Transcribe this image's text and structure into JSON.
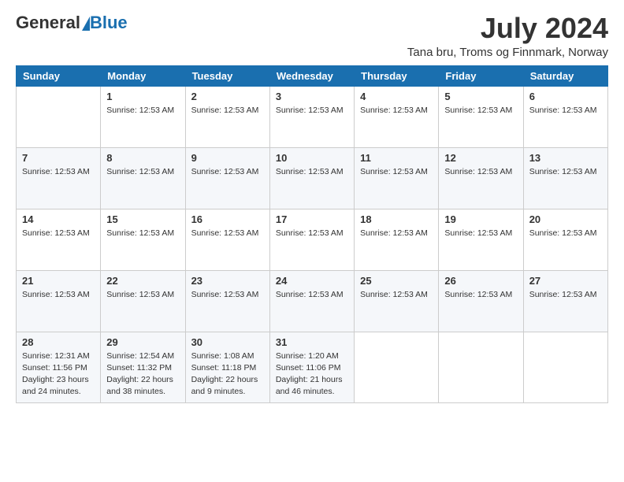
{
  "header": {
    "logo_general": "General",
    "logo_blue": "Blue",
    "month_year": "July 2024",
    "location": "Tana bru, Troms og Finnmark, Norway"
  },
  "weekdays": [
    "Sunday",
    "Monday",
    "Tuesday",
    "Wednesday",
    "Thursday",
    "Friday",
    "Saturday"
  ],
  "weeks": [
    [
      {
        "day": "",
        "info": []
      },
      {
        "day": "1",
        "info": [
          "Sunrise: 12:53 AM"
        ]
      },
      {
        "day": "2",
        "info": [
          "Sunrise: 12:53 AM"
        ]
      },
      {
        "day": "3",
        "info": [
          "Sunrise: 12:53 AM"
        ]
      },
      {
        "day": "4",
        "info": [
          "Sunrise: 12:53 AM"
        ]
      },
      {
        "day": "5",
        "info": [
          "Sunrise: 12:53 AM"
        ]
      },
      {
        "day": "6",
        "info": [
          "Sunrise: 12:53 AM"
        ]
      }
    ],
    [
      {
        "day": "7",
        "info": [
          "Sunrise: 12:53 AM"
        ]
      },
      {
        "day": "8",
        "info": [
          "Sunrise: 12:53 AM"
        ]
      },
      {
        "day": "9",
        "info": [
          "Sunrise: 12:53 AM"
        ]
      },
      {
        "day": "10",
        "info": [
          "Sunrise: 12:53 AM"
        ]
      },
      {
        "day": "11",
        "info": [
          "Sunrise: 12:53 AM"
        ]
      },
      {
        "day": "12",
        "info": [
          "Sunrise: 12:53 AM"
        ]
      },
      {
        "day": "13",
        "info": [
          "Sunrise: 12:53 AM"
        ]
      }
    ],
    [
      {
        "day": "14",
        "info": [
          "Sunrise: 12:53 AM"
        ]
      },
      {
        "day": "15",
        "info": [
          "Sunrise: 12:53 AM"
        ]
      },
      {
        "day": "16",
        "info": [
          "Sunrise: 12:53 AM"
        ]
      },
      {
        "day": "17",
        "info": [
          "Sunrise: 12:53 AM"
        ]
      },
      {
        "day": "18",
        "info": [
          "Sunrise: 12:53 AM"
        ]
      },
      {
        "day": "19",
        "info": [
          "Sunrise: 12:53 AM"
        ]
      },
      {
        "day": "20",
        "info": [
          "Sunrise: 12:53 AM"
        ]
      }
    ],
    [
      {
        "day": "21",
        "info": [
          "Sunrise: 12:53 AM"
        ]
      },
      {
        "day": "22",
        "info": [
          "Sunrise: 12:53 AM"
        ]
      },
      {
        "day": "23",
        "info": [
          "Sunrise: 12:53 AM"
        ]
      },
      {
        "day": "24",
        "info": [
          "Sunrise: 12:53 AM"
        ]
      },
      {
        "day": "25",
        "info": [
          "Sunrise: 12:53 AM"
        ]
      },
      {
        "day": "26",
        "info": [
          "Sunrise: 12:53 AM"
        ]
      },
      {
        "day": "27",
        "info": [
          "Sunrise: 12:53 AM"
        ]
      }
    ],
    [
      {
        "day": "28",
        "info": [
          "Sunrise: 12:31 AM",
          "Sunset: 11:56 PM",
          "Daylight: 23 hours",
          "and 24 minutes."
        ]
      },
      {
        "day": "29",
        "info": [
          "Sunrise: 12:54 AM",
          "Sunset: 11:32 PM",
          "Daylight: 22 hours",
          "and 38 minutes."
        ]
      },
      {
        "day": "30",
        "info": [
          "Sunrise: 1:08 AM",
          "Sunset: 11:18 PM",
          "Daylight: 22 hours",
          "and 9 minutes."
        ]
      },
      {
        "day": "31",
        "info": [
          "Sunrise: 1:20 AM",
          "Sunset: 11:06 PM",
          "Daylight: 21 hours",
          "and 46 minutes."
        ]
      },
      {
        "day": "",
        "info": []
      },
      {
        "day": "",
        "info": []
      },
      {
        "day": "",
        "info": []
      }
    ]
  ]
}
